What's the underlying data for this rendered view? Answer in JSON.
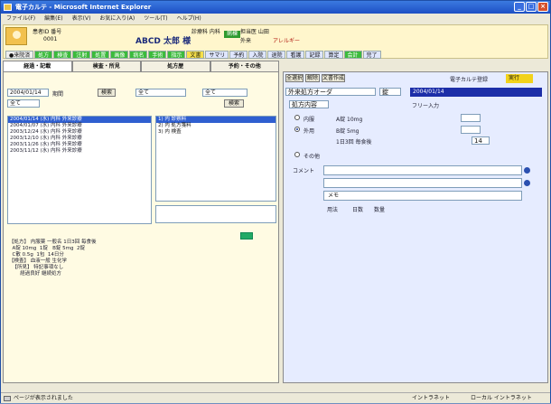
{
  "window": {
    "title": "電子カルテ - Microsoft Internet Explorer"
  },
  "menu": [
    "ファイル(F)",
    "編集(E)",
    "表示(V)",
    "お気に入り(A)",
    "ツール(T)",
    "ヘルプ(H)"
  ],
  "header": {
    "patient_id_label": "患者ID 番号",
    "patient_id": "0001",
    "patient_name": "ABCD 太郎 様",
    "ward_label": "病棟",
    "allergy": "アレルギー",
    "info_a": "診療科 内科",
    "info_b": "担当医 山田",
    "info_c": "外来",
    "status_items": [
      "●来院済",
      "処方",
      "検査",
      "注射",
      "処置",
      "画像",
      "病名",
      "手術",
      "指示",
      "文書",
      "サマリ",
      "予約",
      "入院",
      "退院",
      "看護",
      "記録",
      "算定",
      "会計",
      "完了"
    ]
  },
  "tabs": [
    "経過・記載",
    "検査・所見",
    "処方歴",
    "予約・その他"
  ],
  "left": {
    "date_value": "2004/01/14",
    "period_label": "期間",
    "kind_value": "全て",
    "search_button": "検索",
    "list_rows": [
      "2004/01/14 (水) 内科 外来診療",
      "2004/01/07 (水) 内科 外来診療",
      "2003/12/24 (水) 内科 外来診療",
      "2003/12/10 (水) 内科 外来診療",
      "2003/11/26 (水) 内科 外来診療",
      "2003/11/12 (水) 内科 外来診療"
    ],
    "detail_rows": [
      "1) 内 診察料",
      "2) 内 処方箋料",
      "3) 内 検査"
    ],
    "document_text": "【処方】 内服薬 一般名 1日3回 毎食後\n  A錠 10mg  1錠   B錠 5mg  2錠\n  C散 0.5g  1包  14日分\n【検査】 血液一般 生化学\n  【所見】 特記事項なし\n       経過良好 継続処方"
  },
  "right": {
    "toolbar": [
      "全選択",
      "解除",
      "文書作成"
    ],
    "checkbox_label": "電子カルテ登録",
    "exec_button": "実行",
    "select_value": "外来処方オーダ",
    "unit_value": "錠",
    "date_value": "2004/01/14",
    "section_label": "処方内容",
    "option_a": "内服",
    "option_b": "外用",
    "option_c": "その他",
    "drug_a": "A錠 10mg",
    "drug_b": "B錠 5mg",
    "usage": "1日3回 毎食後",
    "days": "14",
    "comment_label": "コメント",
    "memo_label": "メモ",
    "sub_select": "フリー入力",
    "footer_a": "用法",
    "footer_b": "日数",
    "footer_c": "数量"
  },
  "statusbar": {
    "left": "ページが表示されました",
    "mid": "イントラネット",
    "right": "ローカル イントラネット"
  }
}
